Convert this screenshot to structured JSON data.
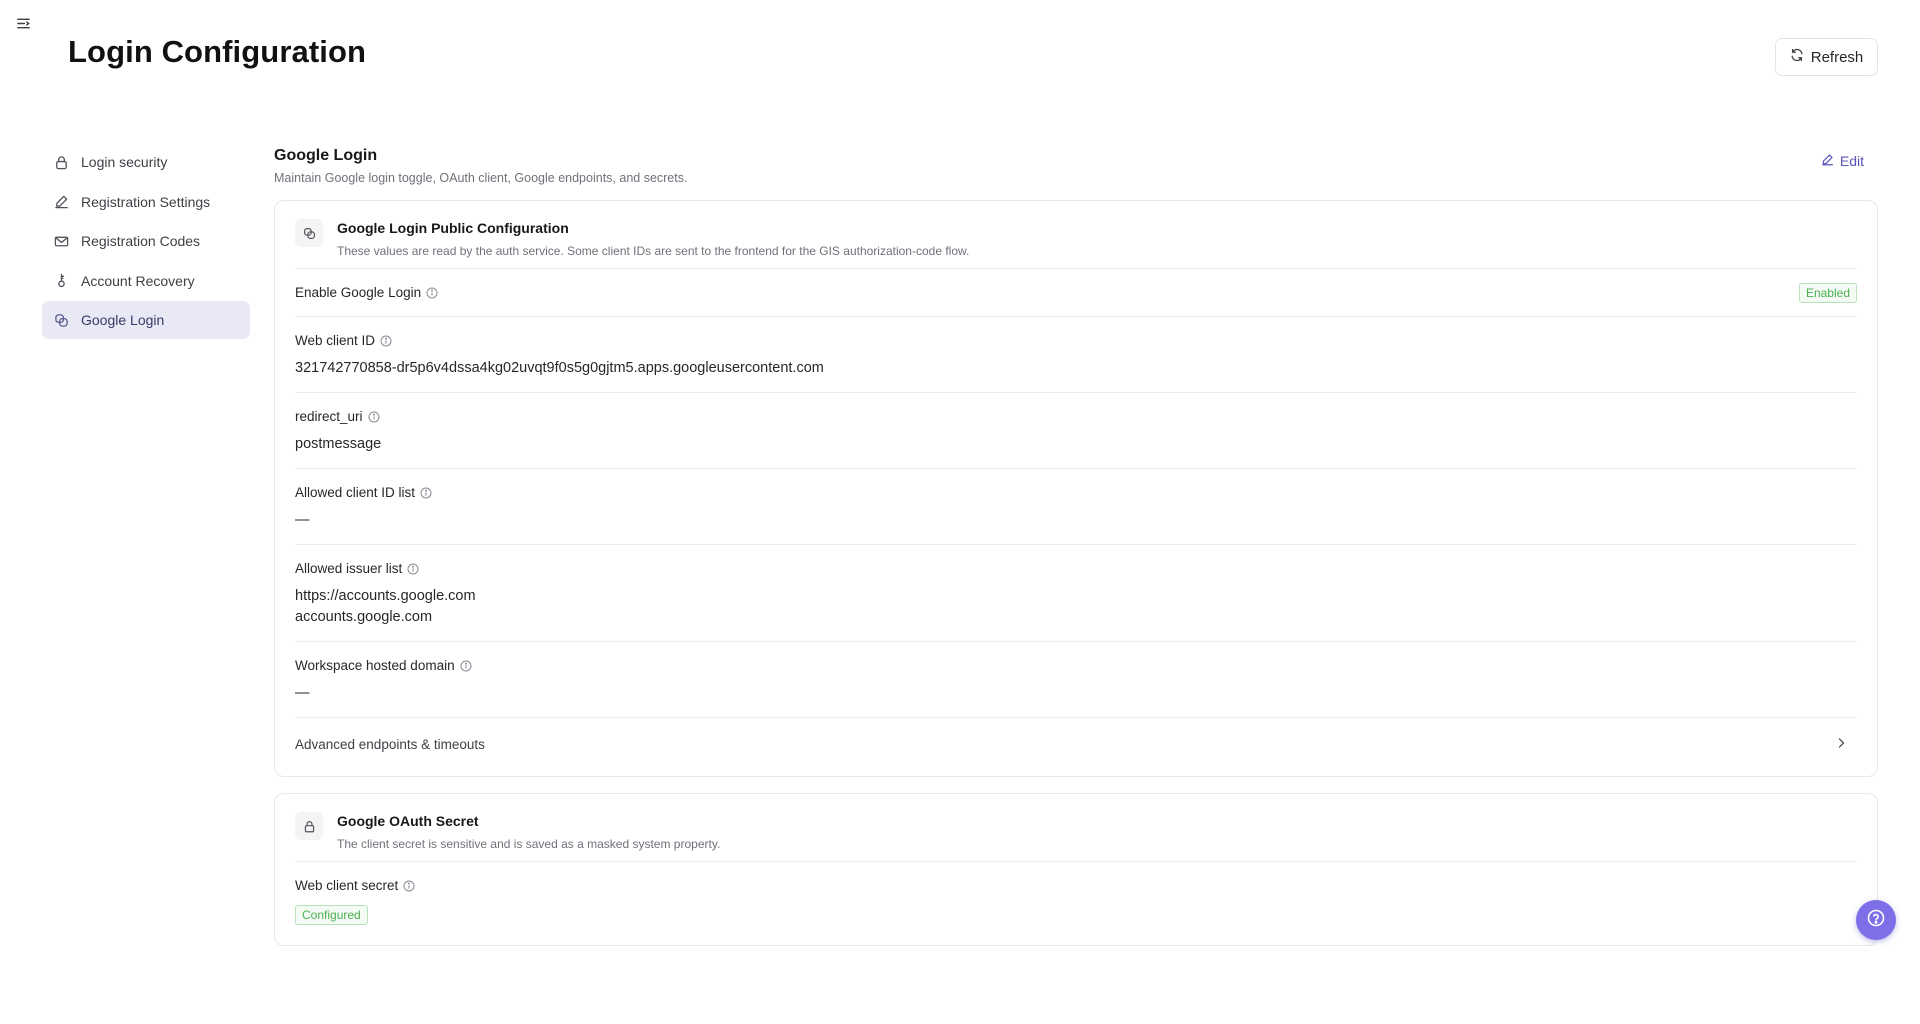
{
  "page": {
    "title": "Login Configuration",
    "refresh_label": "Refresh"
  },
  "sidebar": {
    "items": [
      {
        "label": "Login security",
        "icon": "lock-icon",
        "active": false
      },
      {
        "label": "Registration Settings",
        "icon": "pen-icon",
        "active": false
      },
      {
        "label": "Registration Codes",
        "icon": "mail-icon",
        "active": false
      },
      {
        "label": "Account Recovery",
        "icon": "key-icon",
        "active": false
      },
      {
        "label": "Google Login",
        "icon": "link-icon",
        "active": true
      }
    ]
  },
  "section": {
    "title": "Google Login",
    "subtitle": "Maintain Google login toggle, OAuth client, Google endpoints, and secrets.",
    "edit_label": "Edit"
  },
  "public_config": {
    "title": "Google Login Public Configuration",
    "subtitle": "These values are read by the auth service. Some client IDs are sent to the frontend for the GIS authorization-code flow.",
    "enable_label": "Enable Google Login",
    "enable_status": "Enabled",
    "web_client_id_label": "Web client ID",
    "web_client_id_value": "321742770858-dr5p6v4dssa4kg02uvqt9f0s5g0gjtm5.apps.googleusercontent.com",
    "redirect_uri_label": "redirect_uri",
    "redirect_uri_value": "postmessage",
    "allowed_client_ids_label": "Allowed client ID list",
    "allowed_client_ids_value": "—",
    "allowed_issuers_label": "Allowed issuer list",
    "allowed_issuers_values": [
      "https://accounts.google.com",
      "accounts.google.com"
    ],
    "hosted_domain_label": "Workspace hosted domain",
    "hosted_domain_value": "—",
    "advanced_label": "Advanced endpoints & timeouts"
  },
  "secret": {
    "title": "Google OAuth Secret",
    "subtitle": "The client secret is sensitive and is saved as a masked system property.",
    "web_client_secret_label": "Web client secret",
    "web_client_secret_status": "Configured"
  },
  "colors": {
    "accent": "#5b54b8",
    "active_bg": "#e9e8f5",
    "success": "#4caf50",
    "fab": "#7c6fe8"
  }
}
